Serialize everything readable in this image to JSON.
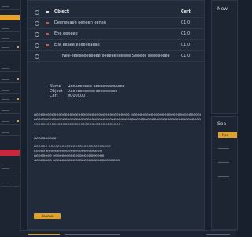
{
  "list": {
    "header": {
      "name": "Object",
      "code": "Cert"
    },
    "rows": [
      {
        "name": "Deeneeaen eeneen eenee",
        "code": "01.0",
        "square": "red"
      },
      {
        "name": "Ene eeneee",
        "code": "01.0",
        "square": "red"
      },
      {
        "name": "Elle eeaee elleelleaeae",
        "code": "01.0",
        "square": "red"
      },
      {
        "name": "Nee-eeeneeeeeeee eeeeeeeeeeee  Seeeee eeeeeeeee",
        "code": "01.0",
        "square": ""
      }
    ]
  },
  "detail": {
    "fields": [
      {
        "k": "Name",
        "v": "Aeeeeeeeee eeeeeeeeeeeee"
      },
      {
        "k": "Object",
        "v": "Aeeeeeeeeee aeeeeeeee"
      },
      {
        "k": "Cert",
        "v": "0000000"
      }
    ],
    "paragraph1": [
      "Aeeeeeeeeeeeeeeeeeeeeeeeeeeeeeeeeeeeeeeeeee eeeeeeeeeeeeeeeeeeeeeeeeeeeeeeeeeeeeeeeeeeeeee",
      "eeeeeeeeeeeeeeeeeeeeeeeeeeeeeeeeeeeeeeeeeeeeeeeeeeeeeeeeeeeeeeeeeeeeeeeeeeeeeeeeeeeeeeeeeeeee",
      "eeeeeeeeeeeeeeeeeeeeeeeeeeeeeeeeeeeeeee."
    ],
    "paragraph2_title": "Aeeeeeeeee:",
    "paragraph2": [
      "Aeeeee eeeeeeeeeeeeeeeeeeeeeeeeeeee",
      "Eeeee eeeeeeeeeeeeeeeeeeeeeeeee",
      "Aeeeeeee eeeeeeeeeeeeeeeeeeeeeee",
      "Aeeeeeee eeeeeeeeeeeeeeeeeeeeeeeeeeeeee"
    ]
  },
  "main_button": "Aeeeee",
  "right_top": {
    "title": "New"
  },
  "right_bottom": {
    "title": "Sea",
    "button": "Nee"
  },
  "colors": {
    "accent": "#e0a128",
    "danger": "#c8283c",
    "background": "#17202c"
  }
}
